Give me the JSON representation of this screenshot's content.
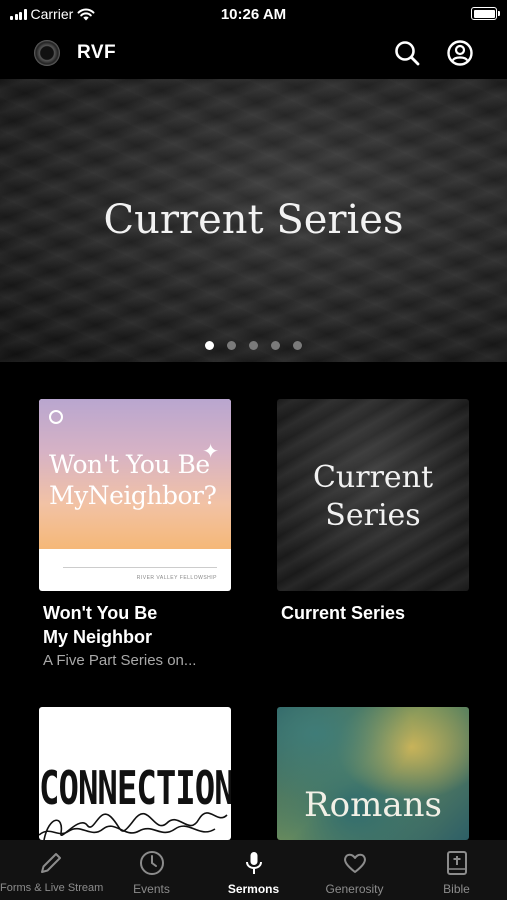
{
  "status_bar": {
    "carrier": "Carrier",
    "time": "10:26 AM"
  },
  "header": {
    "brand": "RVF",
    "icons": [
      "search-icon",
      "account-icon"
    ]
  },
  "hero": {
    "title": "Current Series",
    "carousel": {
      "count": 5,
      "active_index": 0
    }
  },
  "cards": [
    {
      "title_line1": "Won't You Be",
      "title_line2": "My Neighbor",
      "subtitle": "A Five Part Series on...",
      "art_text_line1": "Won't You Be",
      "art_text_line2": "MyNeighbor?",
      "art_caption": "RIVER VALLEY FELLOWSHIP"
    },
    {
      "title": "Current Series",
      "art_text_line1": "Current",
      "art_text_line2": "Series"
    },
    {
      "art_text": "CONNECTION"
    },
    {
      "art_text": "Romans"
    }
  ],
  "tabs": [
    {
      "label": "Forms & Live Stream",
      "icon": "pencil-icon",
      "active": false
    },
    {
      "label": "Events",
      "icon": "clock-icon",
      "active": false
    },
    {
      "label": "Sermons",
      "icon": "microphone-icon",
      "active": true
    },
    {
      "label": "Generosity",
      "icon": "heart-icon",
      "active": false
    },
    {
      "label": "Bible",
      "icon": "bible-icon",
      "active": false
    }
  ],
  "colors": {
    "background": "#000000",
    "tab_inactive": "#8c8c8c",
    "tab_active": "#ffffff",
    "subtitle": "#a9a9a9"
  }
}
